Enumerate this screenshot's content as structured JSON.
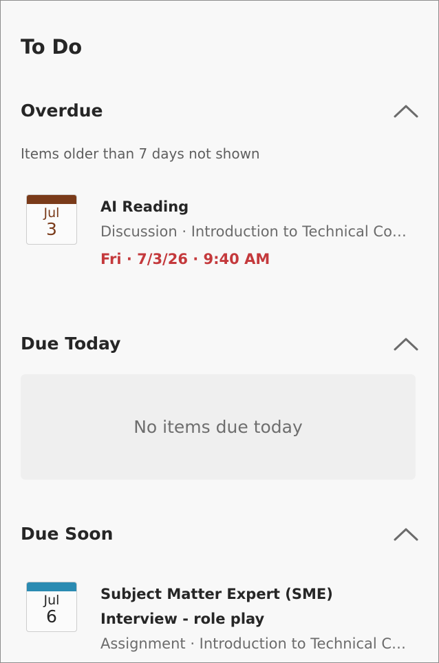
{
  "panel": {
    "title": "To Do"
  },
  "colors": {
    "overdue_text": "#c4393c",
    "overdue_band": "#7a3b1a",
    "overdue_calendar_text": "#7a3b1a",
    "soon_band": "#2b8bb2",
    "soon_calendar_text": "#262626",
    "collapse_icon": "#6b6b6b"
  },
  "overdue": {
    "title": "Overdue",
    "toggle_icon": "chevron-up-icon",
    "note": "Items older than 7 days not shown",
    "items": [
      {
        "calendar_month": "Jul",
        "calendar_day": "3",
        "title": "AI Reading",
        "meta": "Discussion · Introduction to Technical Communication",
        "due": "Fri · 7/3/26 · 9:40 AM"
      }
    ]
  },
  "due_today": {
    "title": "Due Today",
    "toggle_icon": "chevron-up-icon",
    "empty_message": "No items due today"
  },
  "due_soon": {
    "title": "Due Soon",
    "toggle_icon": "chevron-up-icon",
    "items": [
      {
        "calendar_month": "Jul",
        "calendar_day": "6",
        "title": "Subject Matter Expert (SME) Interview - role play",
        "meta": "Assignment · Introduction to Technical Communication"
      }
    ]
  }
}
